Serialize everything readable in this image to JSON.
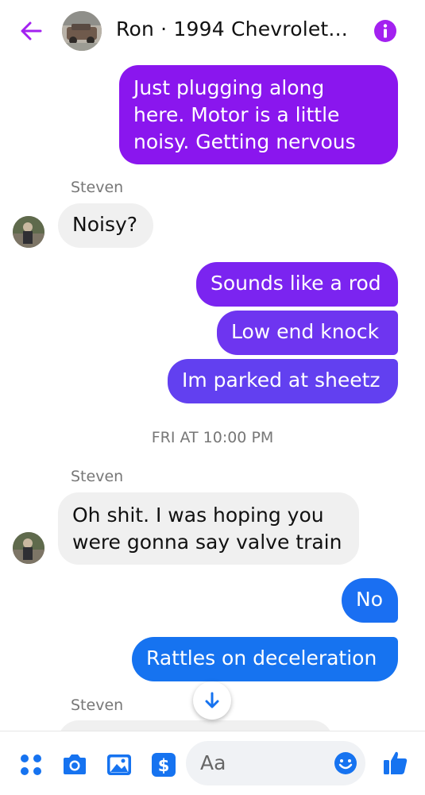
{
  "header": {
    "title": "Ron · 1994 Chevrolet...",
    "back_icon": "back-arrow-icon",
    "info_icon": "info-icon"
  },
  "messages": [
    {
      "direction": "out",
      "text_lines": [
        "Just plugging along",
        "here. Motor is a little",
        "noisy. Getting nervous"
      ]
    },
    {
      "sender": "Steven"
    },
    {
      "direction": "in",
      "text": "Noisy?"
    },
    {
      "direction": "out",
      "text": "Sounds like a rod"
    },
    {
      "direction": "out",
      "text": "Low end knock"
    },
    {
      "direction": "out",
      "text": "Im parked at sheetz"
    },
    {
      "timestamp": "FRI AT 10:00 PM"
    },
    {
      "sender": "Steven"
    },
    {
      "direction": "in",
      "text_lines": [
        "Oh shit. I was hoping you",
        "were gonna say valve train"
      ]
    },
    {
      "direction": "out",
      "text": "No"
    },
    {
      "direction": "out",
      "text": "Rattles on deceleration"
    },
    {
      "sender": "Steven"
    }
  ],
  "composer": {
    "placeholder": "Aa",
    "icons": [
      "apps-icon",
      "camera-icon",
      "gallery-icon",
      "payment-icon",
      "emoji-icon",
      "thumbs-up-icon"
    ]
  },
  "scroll_down_icon": "arrow-down-icon",
  "colors": {
    "accent_purple": "#8a16ee",
    "accent_violet": "#6b3df0",
    "accent_blue": "#1673f0",
    "incoming_bubble": "#f0f0f0"
  }
}
